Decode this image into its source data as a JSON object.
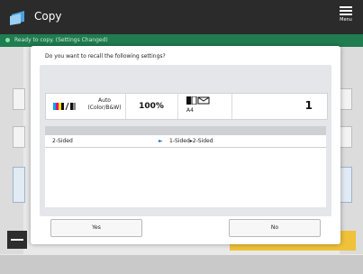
{
  "header": {
    "title": "Copy",
    "menu_label": "Menu"
  },
  "status": {
    "text": "Ready to copy. (Settings Changed)"
  },
  "dialog": {
    "question": "Do you want to recall the following settings?",
    "summary": {
      "color_mode": "Auto\n(Color/B&W)",
      "zoom": "100%",
      "paper": "A4",
      "copies": "1"
    },
    "settings": [
      {
        "name": "2-Sided",
        "value": "1-Sided▸2-Sided"
      }
    ],
    "yes_label": "Yes",
    "no_label": "No"
  },
  "colors": {
    "topbar": "#2b2b2b",
    "statusbar": "#1f7d4f",
    "accent_yellow": "#f0c23a"
  },
  "icons": [
    "copy-app-icon",
    "menu-icon",
    "color-mode-icon",
    "paper-tray-icon",
    "arrow-right-icon"
  ]
}
